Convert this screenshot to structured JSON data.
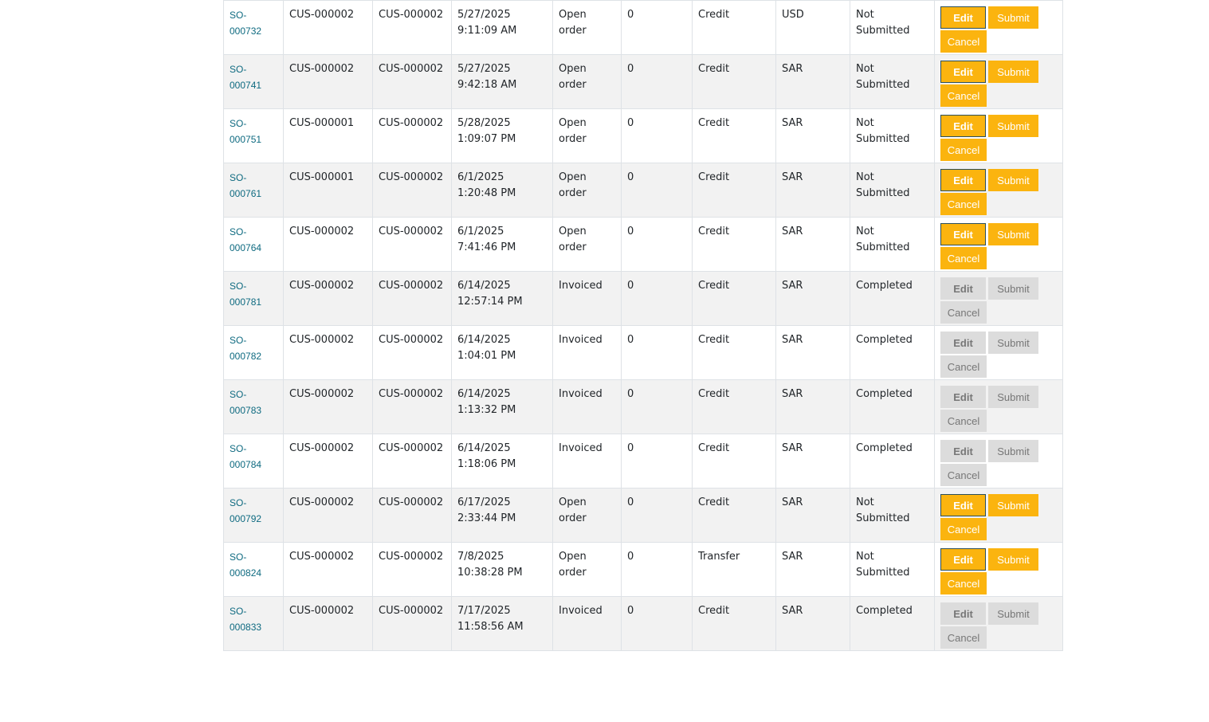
{
  "button_labels": {
    "edit": "Edit",
    "submit": "Submit",
    "cancel": "Cancel"
  },
  "colors": {
    "active_button": "#fbb40f",
    "disabled_button": "#dcdcdc",
    "link": "#0e6a80"
  },
  "rows": [
    {
      "id": "SO-000732",
      "customer": "CUS-000002",
      "customer2": "CUS-000002",
      "date": "5/27/2025 9:11:09 AM",
      "order_status": "Open order",
      "amount": "0",
      "payment": "Credit",
      "currency": "USD",
      "submit_status": "Not Submitted",
      "actions_enabled": true
    },
    {
      "id": "SO-000741",
      "customer": "CUS-000002",
      "customer2": "CUS-000002",
      "date": "5/27/2025 9:42:18 AM",
      "order_status": "Open order",
      "amount": "0",
      "payment": "Credit",
      "currency": "SAR",
      "submit_status": "Not Submitted",
      "actions_enabled": true
    },
    {
      "id": "SO-000751",
      "customer": "CUS-000001",
      "customer2": "CUS-000002",
      "date": "5/28/2025 1:09:07 PM",
      "order_status": "Open order",
      "amount": "0",
      "payment": "Credit",
      "currency": "SAR",
      "submit_status": "Not Submitted",
      "actions_enabled": true
    },
    {
      "id": "SO-000761",
      "customer": "CUS-000001",
      "customer2": "CUS-000002",
      "date": "6/1/2025 1:20:48 PM",
      "order_status": "Open order",
      "amount": "0",
      "payment": "Credit",
      "currency": "SAR",
      "submit_status": "Not Submitted",
      "actions_enabled": true
    },
    {
      "id": "SO-000764",
      "customer": "CUS-000002",
      "customer2": "CUS-000002",
      "date": "6/1/2025 7:41:46 PM",
      "order_status": "Open order",
      "amount": "0",
      "payment": "Credit",
      "currency": "SAR",
      "submit_status": "Not Submitted",
      "actions_enabled": true
    },
    {
      "id": "SO-000781",
      "customer": "CUS-000002",
      "customer2": "CUS-000002",
      "date": "6/14/2025 12:57:14 PM",
      "order_status": "Invoiced",
      "amount": "0",
      "payment": "Credit",
      "currency": "SAR",
      "submit_status": "Completed",
      "actions_enabled": false
    },
    {
      "id": "SO-000782",
      "customer": "CUS-000002",
      "customer2": "CUS-000002",
      "date": "6/14/2025 1:04:01 PM",
      "order_status": "Invoiced",
      "amount": "0",
      "payment": "Credit",
      "currency": "SAR",
      "submit_status": "Completed",
      "actions_enabled": false
    },
    {
      "id": "SO-000783",
      "customer": "CUS-000002",
      "customer2": "CUS-000002",
      "date": "6/14/2025 1:13:32 PM",
      "order_status": "Invoiced",
      "amount": "0",
      "payment": "Credit",
      "currency": "SAR",
      "submit_status": "Completed",
      "actions_enabled": false
    },
    {
      "id": "SO-000784",
      "customer": "CUS-000002",
      "customer2": "CUS-000002",
      "date": "6/14/2025 1:18:06 PM",
      "order_status": "Invoiced",
      "amount": "0",
      "payment": "Credit",
      "currency": "SAR",
      "submit_status": "Completed",
      "actions_enabled": false
    },
    {
      "id": "SO-000792",
      "customer": "CUS-000002",
      "customer2": "CUS-000002",
      "date": "6/17/2025 2:33:44 PM",
      "order_status": "Open order",
      "amount": "0",
      "payment": "Credit",
      "currency": "SAR",
      "submit_status": "Not Submitted",
      "actions_enabled": true
    },
    {
      "id": "SO-000824",
      "customer": "CUS-000002",
      "customer2": "CUS-000002",
      "date": "7/8/2025 10:38:28 PM",
      "order_status": "Open order",
      "amount": "0",
      "payment": "Transfer",
      "currency": "SAR",
      "submit_status": "Not Submitted",
      "actions_enabled": true
    },
    {
      "id": "SO-000833",
      "customer": "CUS-000002",
      "customer2": "CUS-000002",
      "date": "7/17/2025 11:58:56 AM",
      "order_status": "Invoiced",
      "amount": "0",
      "payment": "Credit",
      "currency": "SAR",
      "submit_status": "Completed",
      "actions_enabled": false
    }
  ]
}
